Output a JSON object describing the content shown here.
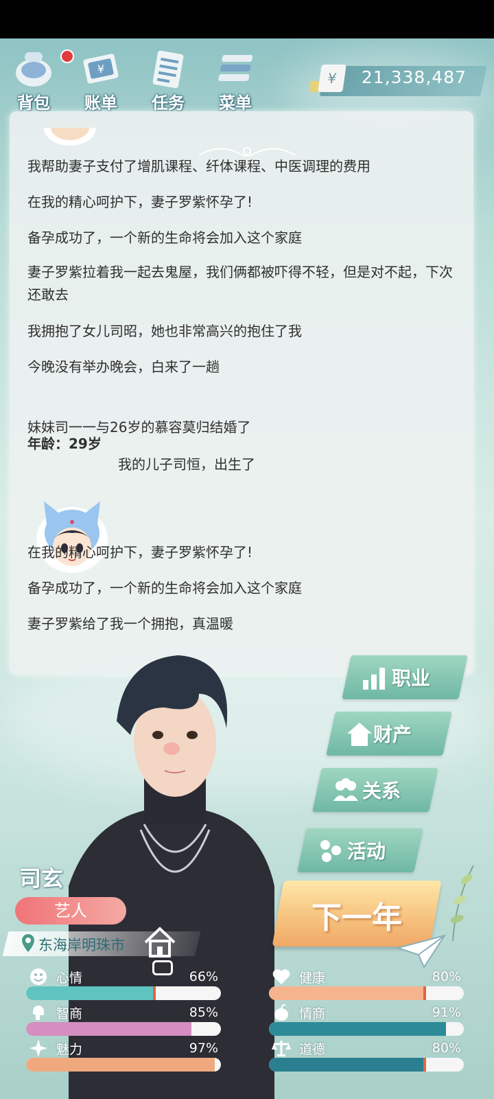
{
  "nav": {
    "items": [
      {
        "label": "背包",
        "icon": "backpack-icon"
      },
      {
        "label": "账单",
        "icon": "bill-icon"
      },
      {
        "label": "任务",
        "icon": "task-icon"
      },
      {
        "label": "菜单",
        "icon": "menu-icon"
      }
    ],
    "money_symbol": "¥",
    "money": "21,338,487"
  },
  "log": {
    "lines_before": [
      "我帮助妻子支付了增肌课程、纤体课程、中医调理的费用",
      "在我的精心呵护下，妻子罗紫怀孕了!",
      "备孕成功了，一个新的生命将会加入这个家庭",
      "妻子罗紫拉着我一起去鬼屋，我们俩都被吓得不轻，但是对不起，下次还敢去",
      "我拥抱了女儿司昭，她也非常高兴的抱住了我",
      "今晚没有举办晚会，白来了一趟"
    ],
    "age_label": "年龄：29岁",
    "marriage": "妹妹司一一与26岁的慕容莫归结婚了",
    "birth": "我的儿子司恒，出生了",
    "lines_after": [
      "在我的精心呵护下，妻子罗紫怀孕了!",
      "备孕成功了，一个新的生命将会加入这个家庭",
      "妻子罗紫给了我一个拥抱，真温暖"
    ]
  },
  "side_buttons": [
    {
      "label": "职业",
      "icon": "career-icon"
    },
    {
      "label": "财产",
      "icon": "house-icon"
    },
    {
      "label": "关系",
      "icon": "people-icon"
    },
    {
      "label": "活动",
      "icon": "activity-icon"
    }
  ],
  "next_button": "下一年",
  "character": {
    "name": "司玄",
    "job": "艺人",
    "location": "东海岸明珠市"
  },
  "stats": [
    {
      "label": "心情",
      "value": "66%",
      "fraction": 0.66,
      "icon": "smile-icon",
      "color": "#5fc3c0"
    },
    {
      "label": "健康",
      "value": "80%",
      "fraction": 0.8,
      "icon": "heart-icon",
      "color": "#f5b48d"
    },
    {
      "label": "智商",
      "value": "85%",
      "fraction": 0.85,
      "icon": "brain-icon",
      "color": "#d48ec0"
    },
    {
      "label": "情商",
      "value": "91%",
      "fraction": 0.91,
      "icon": "apple-icon",
      "color": "#2d8b97"
    },
    {
      "label": "魅力",
      "value": "97%",
      "fraction": 0.97,
      "icon": "sparkle-icon",
      "color": "#f0a97e"
    },
    {
      "label": "道德",
      "value": "80%",
      "fraction": 0.8,
      "icon": "scale-icon",
      "color": "#2a7f90"
    }
  ]
}
